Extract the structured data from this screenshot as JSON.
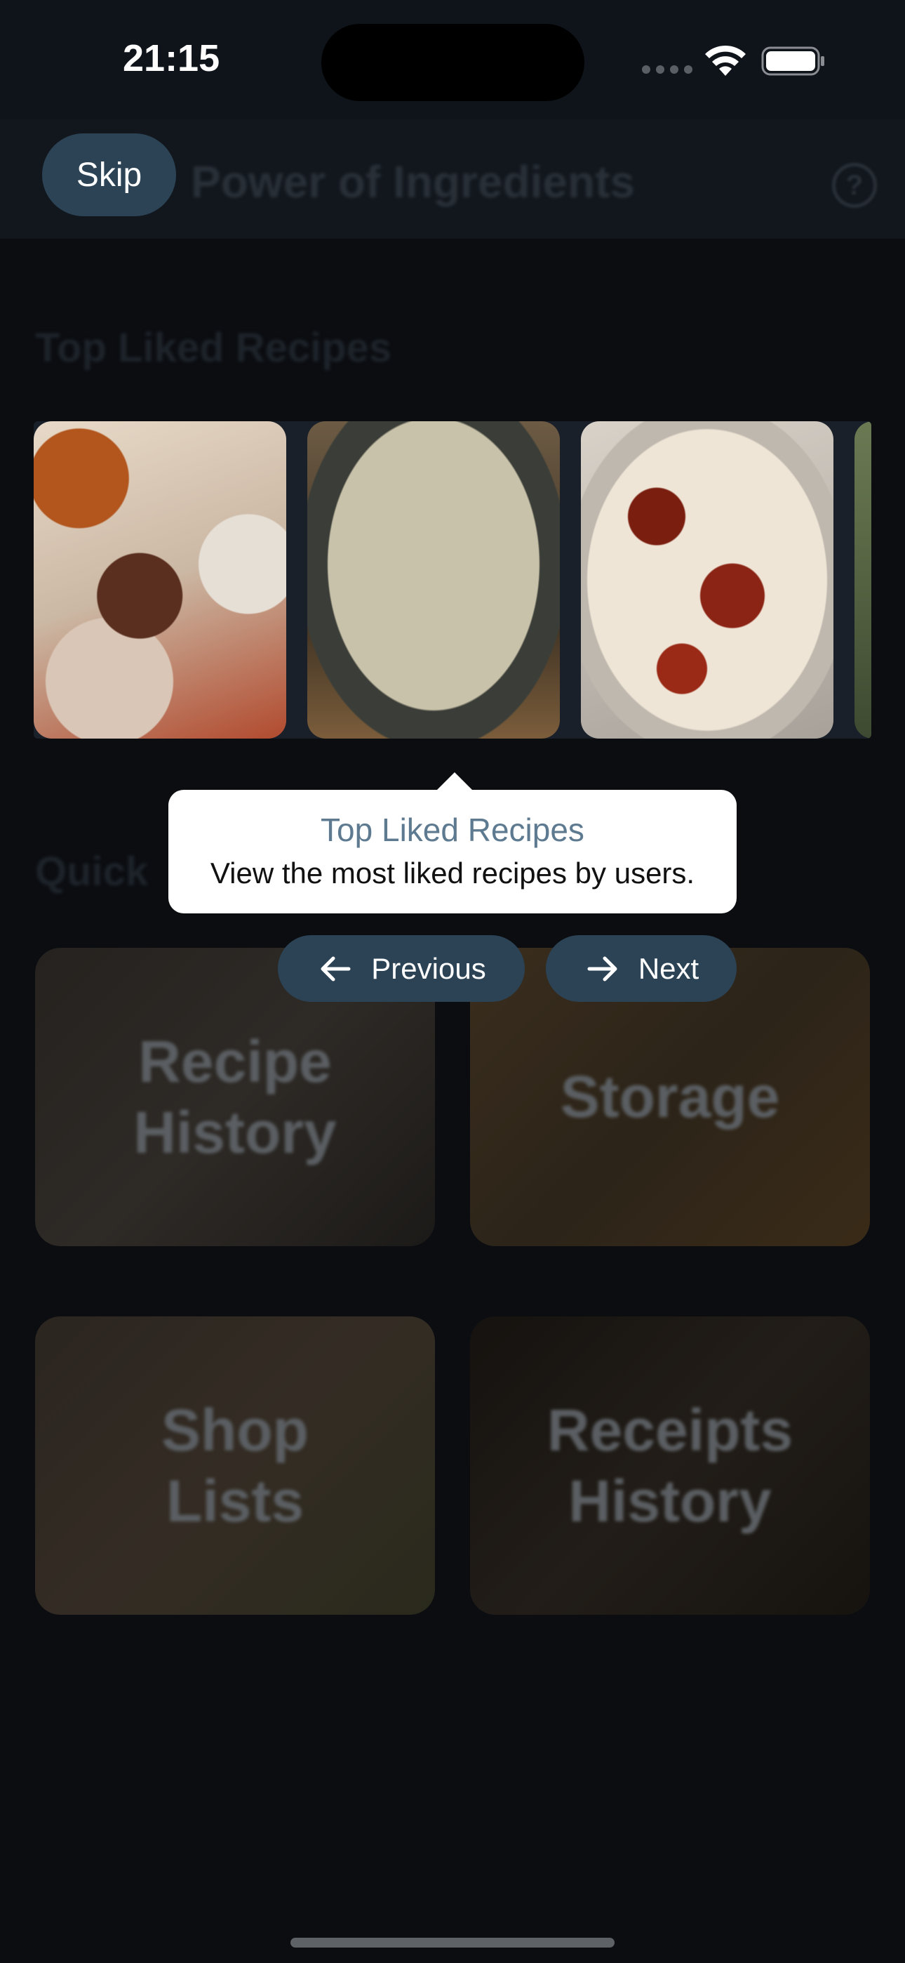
{
  "status_bar": {
    "time": "21:15"
  },
  "app_bar": {
    "skip_label": "Skip",
    "title": "Power of Ingredients",
    "help_glyph": "?"
  },
  "sections": {
    "top_liked_title": "Top Liked Recipes",
    "quick_title": "Quick"
  },
  "quick_cards": [
    {
      "label": "Recipe\nHistory"
    },
    {
      "label": "Storage"
    },
    {
      "label": "Shop\nLists"
    },
    {
      "label": "Receipts\nHistory"
    }
  ],
  "tooltip": {
    "title": "Top Liked Recipes",
    "description": "View the most liked recipes by users."
  },
  "tour_nav": {
    "previous_label": "Previous",
    "next_label": "Next"
  },
  "colors": {
    "button_bg": "#2b4355",
    "tooltip_title": "#5d7a90",
    "background": "#0b0d11"
  },
  "icons": [
    "wifi-icon",
    "battery-icon",
    "help-icon",
    "arrow-left-icon",
    "arrow-right-icon"
  ]
}
